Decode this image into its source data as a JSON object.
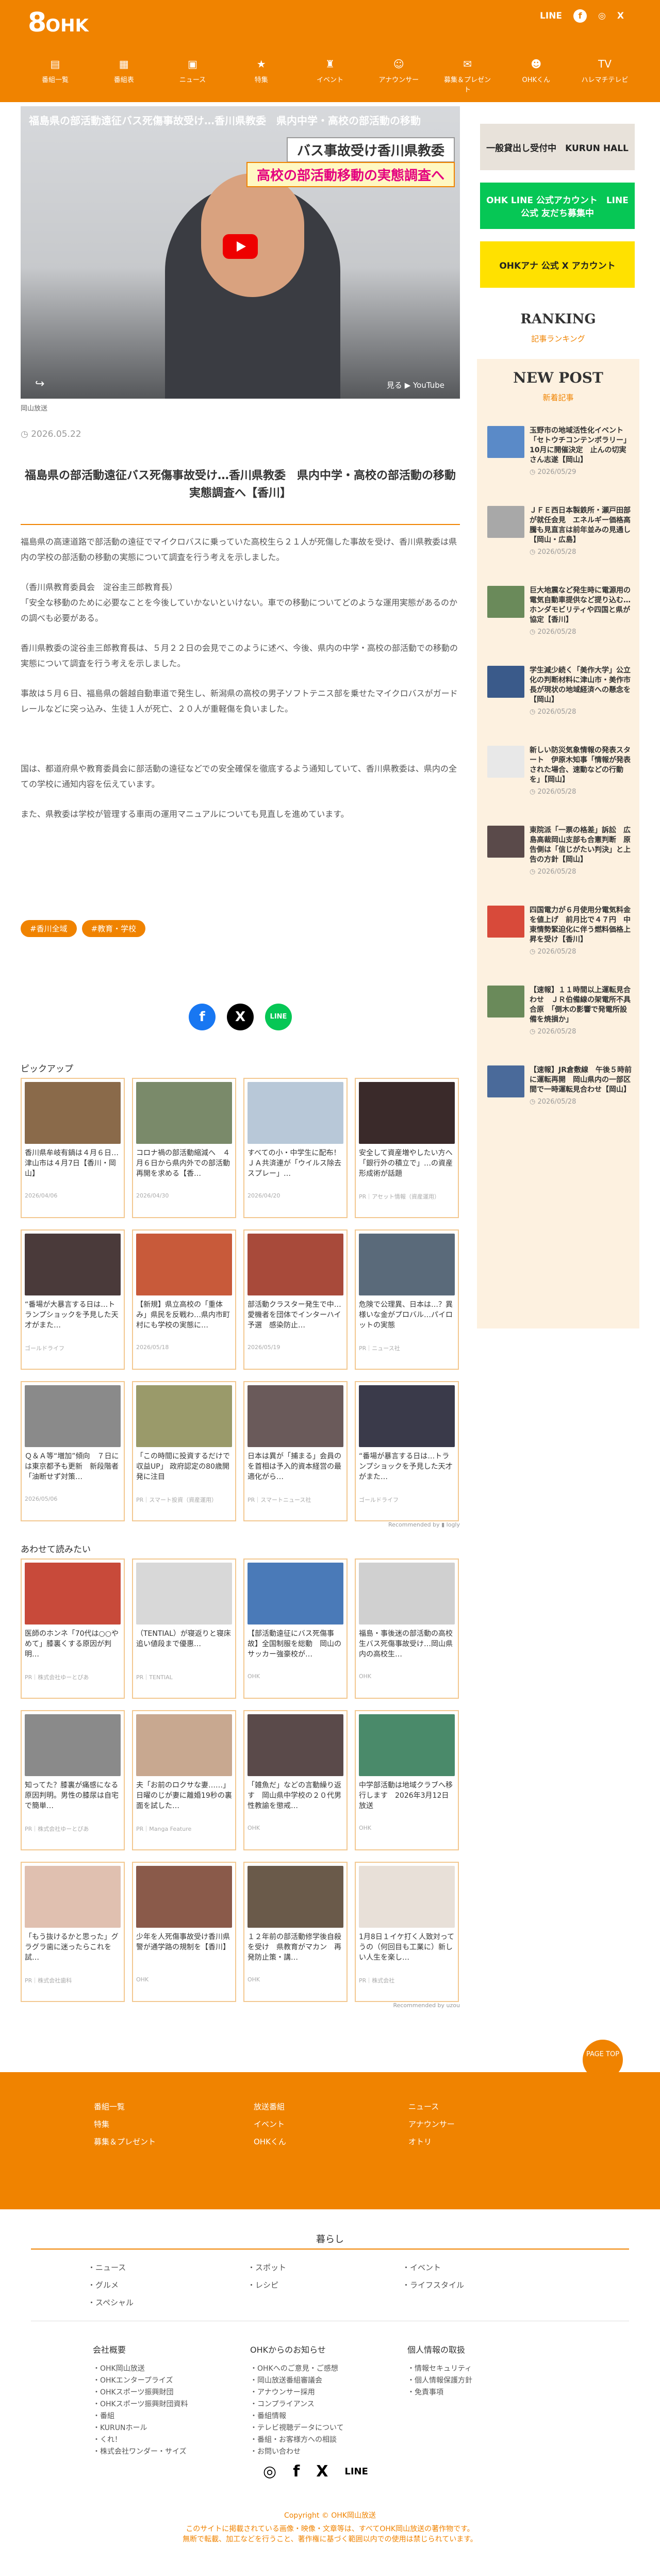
{
  "header": {
    "logo_num": "8",
    "logo_text": "OHK",
    "social": [
      "LINE",
      "f",
      "◎",
      "X"
    ],
    "nav": [
      {
        "label": "番組一覧",
        "icon": "▤"
      },
      {
        "label": "番組表",
        "icon": "▦"
      },
      {
        "label": "ニュース",
        "icon": "▣"
      },
      {
        "label": "特集",
        "icon": "★"
      },
      {
        "label": "イベント",
        "icon": "♜"
      },
      {
        "label": "アナウンサー",
        "icon": "☺"
      },
      {
        "label": "募集＆プレゼント",
        "icon": "✉"
      },
      {
        "label": "OHKくん",
        "icon": "☻"
      },
      {
        "label": "ハレマチテレビ",
        "icon": "TV"
      }
    ]
  },
  "article": {
    "video_title": "福島県の部活動遠征バス死傷事故受け…香川県教委　県内中学・高校の部活動の移動",
    "video_caption1": "バス事故受け香川県教委",
    "video_caption2": "高校の部活動移動の実態調査へ",
    "video_watch": "見る ▶ YouTube",
    "video_credit": "岡山放送",
    "date": "◷ 2026.05.22",
    "title": "福島県の部活動遠征バス死傷事故受け…香川県教委　県内中学・高校の部活動の移動実態調査へ【香川】",
    "paragraphs": [
      "福島県の高速道路で部活動の遠征でマイクロバスに乗っていた高校生ら２１人が死傷した事故を受け、香川県教委は県内の学校の部活動の移動の実態について調査を行う考えを示しました。",
      "（香川県教育委員会　淀谷圭三郎教育長）\n「安全な移動のために必要なことを今後していかないといけない。車での移動についてどのような運用実態があるのかの調べも必要がある。",
      "香川県教委の淀谷圭三郎教育長は、５月２２日の会見でこのように述べ、今後、県内の中学・高校の部活動での移動の実態について調査を行う考えを示しました。",
      "事故は５月６日、福島県の磐越自動車道で発生し、新潟県の高校の男子ソフトテニス部を乗せたマイクロバスがガードレールなどに突っ込み、生徒１人が死亡、２０人が重軽傷を負いました。",
      "",
      "国は、都道府県や教育委員会に部活動の遠征などでの安全確保を徹底するよう通知していて、香川県教委は、県内の全ての学校に通知内容を伝えています。",
      "また、県教委は学校が管理する車両の運用マニュアルについても見直しを進めています。"
    ],
    "tags": [
      "#香川全域",
      "#教育・学校"
    ],
    "share": [
      "f",
      "X",
      "LINE"
    ]
  },
  "pickup": {
    "title": "ピックアップ",
    "items": [
      {
        "text": "香川県牟岐有鍋は４月６日…津山市は４月7日【香川・岡山】",
        "src": "2026/04/06",
        "color": "#8a6a4a"
      },
      {
        "text": "コロナ禍の部活動縮減へ　４月６日から県内外での部活動再開を求める【香…",
        "src": "2026/04/30",
        "color": "#7a8a6a"
      },
      {
        "text": "すべての小・中学生に配布！　ＪＡ共済連が「ウイルス除去スプレー」…",
        "src": "2026/04/20",
        "color": "#b8c8d8"
      },
      {
        "text": "安全して資産増やしたい方へ「銀行外の積立で」…の資産形成術が話題",
        "src": "PR｜アセット情報（資産運用）",
        "color": "#3a2a2a"
      },
      {
        "text": "“番場が大暴言する日は…トランプショックを予見した天才がまた…",
        "src": "ゴールドライフ",
        "color": "#4a3a3a"
      },
      {
        "text": "【新規】県立高校の「重体み」県民を反戦わ…県内市町村にも学校の実態に…",
        "src": "2026/05/18",
        "color": "#c85a3a"
      },
      {
        "text": "部活動クラスター発生で中…愛機者を団体でインターハイ予選　感染防止…",
        "src": "2026/05/19",
        "color": "#a84a3a"
      },
      {
        "text": "危険で公理異、日本は…？異様いな金がプロバル…パイロットの実態",
        "src": "PR｜ニュース社",
        "color": "#5a6a7a"
      },
      {
        "text": "Ｑ＆Ａ等“増加”傾向　７日には東京都予も更新　新段階者「油断せず対策…",
        "src": "2026/05/06",
        "color": "#8a8a8a"
      },
      {
        "text": "「この時間に投資するだけで収益UP」 政府認定の80歳開発に注目",
        "src": "PR｜スマート投資（資産運用）",
        "color": "#9a9a6a"
      },
      {
        "text": "日本は異が「捕まる」会員のを首相は予入的資本経営の最適化がら…",
        "src": "PR｜スマートニュース社",
        "color": "#6a5a5a"
      },
      {
        "text": "“番場が暴言する日は…トランプショックを予見した天才がまた…",
        "src": "ゴールドライフ",
        "color": "#3a3a4a"
      }
    ],
    "rec_by": "Recommended by  ▮ logly"
  },
  "related": {
    "title": "あわせて読みたい",
    "items": [
      {
        "text": "医師のホンネ「70代は○○やめて」膝裏くする原因が判明…",
        "src": "PR｜株式会社ゆーとぴあ",
        "color": "#c84a3a"
      },
      {
        "text": "（TENTIAL）が寝返りと寝床追い値段まで優惠…",
        "src": "PR｜TENTIAL",
        "color": "#d8d8d8"
      },
      {
        "text": "【部活動遠征にバス死傷事故】全国制服を総動　岡山のサッカー強豪校が…",
        "src": "OHK",
        "color": "#4a7ab8"
      },
      {
        "text": "福島・事後迷の部活動の高校生バス死傷事故受け…岡山県内の高校生…",
        "src": "OHK",
        "color": "#d0d0d0"
      },
      {
        "text": "知ってた？膝裏が痛感になる原因判明。男性の膝尿は自宅で簡単…",
        "src": "PR｜株式会社ゆーとぴあ",
        "color": "#8a8a8a"
      },
      {
        "text": "夫「お前のロクサな妻……」日曜のじが妻に離婚19秒の裏面を試した…",
        "src": "PR｜Manga Feature",
        "color": "#c8a890"
      },
      {
        "text": "「雑魚だ」などの言動繰り返す　岡山県中学校の２０代男性教諭を懲戒…",
        "src": "OHK",
        "color": "#5a4a4a"
      },
      {
        "text": "中学部活動は地域クラブへ移行します　2026年3月12日放送",
        "src": "OHK",
        "color": "#4a8a6a"
      },
      {
        "text": "「もう抜けるかと思った」グラグラ歯に迷ったらこれを試…",
        "src": "PR｜株式会社歯科",
        "color": "#e0c0b0"
      },
      {
        "text": "少年を人死傷事故受け香川県警が通学路の規制を【香川】",
        "src": "OHK",
        "color": "#8a5a4a"
      },
      {
        "text": "１２年前の部活動修学後自殺を受け　県教育がマカン　再発防止策・講…",
        "src": "OHK",
        "color": "#6a5a4a"
      },
      {
        "text": "1月8日１イケ打く人致対ってうの（何回目も工業に）新しい人生を楽し…",
        "src": "PR｜株式会社",
        "color": "#e8e0d8"
      }
    ],
    "rec_by": "Recommended by  uzou"
  },
  "sidebar": {
    "banners": [
      {
        "label": "一般貸出し受付中　KURUN HALL",
        "color": "#e8e2da"
      },
      {
        "label": "OHK LINE 公式アカウント　LINE公式 友だち募集中",
        "color": "#06c755"
      },
      {
        "label": "OHKアナ 公式 X アカウント",
        "color": "#ffe100"
      }
    ],
    "ranking_title": "RANKING",
    "ranking_sub": "記事ランキング",
    "newpost_title": "NEW POST",
    "newpost_sub": "新着記事",
    "newposts": [
      {
        "title": "玉野市の地域活性化イベント「セトウチコンテンポラリー」10月に開催決定　止んの切実さん志遂【岡山】",
        "date": "◷ 2026/05/29",
        "color": "#5a8ac8"
      },
      {
        "title": "ＪＦＥ西日本製鉄所・瀬戸田部が就任会見　エネルギー価格高騰も見直言は前年並みの見通し【岡山・広島】",
        "date": "◷ 2026/05/28",
        "color": "#a8a8a8"
      },
      {
        "title": "巨大地震など発生時に電源用の電気自動車提供など提り込む…ホンダモビリティや四国と県が協定【香川】",
        "date": "◷ 2026/05/28",
        "color": "#6a8a5a"
      },
      {
        "title": "学生減少続く「美作大学」公立化の判断材料に津山市・美作市長が現状の地域経済への懸念を【岡山】",
        "date": "◷ 2026/05/28",
        "color": "#3a5a8a"
      },
      {
        "title": "新しい防災気象情報の発表スタート　伊原木知事「情報が発表された場合、速動などの行動を」【岡山】",
        "date": "◷ 2026/05/28",
        "color": "#e8e8e8"
      },
      {
        "title": "東院派「一票の格差」訴訟　広島高裁岡山支部も合憲判断　原告側は「信じがたい判決」と上告の方針【岡山】",
        "date": "◷ 2026/05/28",
        "color": "#5a4a4a"
      },
      {
        "title": "四国電力が６月使用分電気料金を値上げ　前月比で４７円　中東情勢緊迫化に伴う燃料価格上昇を受け【香川】",
        "date": "◷ 2026/05/28",
        "color": "#d84a3a"
      },
      {
        "title": "【速報】１１時間以上運転見合わせ　ＪＲ伯備線の架電所不具合原　「倒木の影響で発電所設備を焼損か」",
        "date": "◷ 2026/05/28",
        "color": "#6a8a5a"
      },
      {
        "title": "【速報】JR倉敷線　午後５時前に運転再開　岡山県内の一部区間で一時運転見合わせ【岡山】",
        "date": "◷ 2026/05/28",
        "color": "#4a6a9a"
      }
    ]
  },
  "footer": {
    "cols": [
      [
        "番組一覧",
        "特集",
        "募集＆プレゼント"
      ],
      [
        "放送番組",
        "イベント",
        "OHKくん"
      ],
      [
        "ニュース",
        "アナウンサー",
        "オトリ"
      ]
    ],
    "pagetop": "PAGE TOP",
    "kurashi_title": "暮らし",
    "kurashi": [
      [
        "ニュース",
        "グルメ",
        "スペシャル"
      ],
      [
        "スポット",
        "レシピ"
      ],
      [
        "イベント",
        "ライフスタイル"
      ]
    ],
    "site_groups": [
      {
        "title": "会社概要",
        "items": [
          "OHK岡山放送",
          "OHKエンタープライズ",
          "OHKスポーツ振興財団",
          "OHKスポーツ振興財団資料",
          "番組",
          "KURUNホール",
          "くれ！",
          "株式会社ワンダー・サイズ"
        ]
      },
      {
        "title": "OHKからのお知らせ",
        "items": [
          "OHKへのご意見・ご感想",
          "岡山放送番組審議会",
          "アナウンサー採用",
          "コンプライアンス",
          "番組情報",
          "テレビ視聴データについて",
          "番組・お客様方への相談",
          "お問い合わせ"
        ]
      },
      {
        "title": "個人情報の取扱",
        "items": [
          "情報セキュリティ",
          "個人情報保護方針",
          "免責事項"
        ]
      }
    ],
    "icons": [
      "◎",
      "f",
      "X",
      "LINE"
    ],
    "copyright": "Copyright © OHK岡山放送",
    "notice": "このサイトに掲載されている画像・映像・文章等は、すべてOHK岡山放送の著作物です。\n無断で転載、加工などを行うこと、著作権に基づく範囲以内での使用は禁じられています。"
  }
}
